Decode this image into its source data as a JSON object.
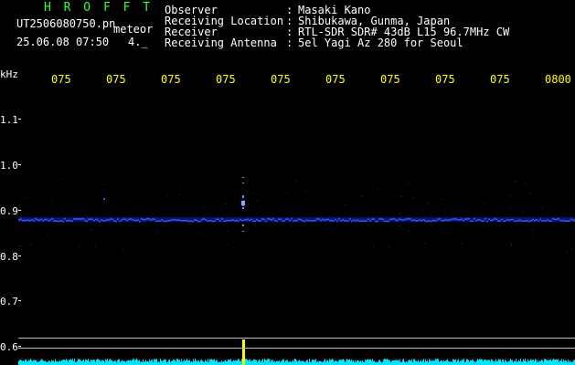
{
  "header": {
    "title": "H R O F F T",
    "filename": "UT2506080750.pn",
    "tag": "meteor",
    "datetime": "25.06.08 07:50",
    "duration": "4._",
    "info": [
      {
        "label": "Observer",
        "sep": ":",
        "value": "Masaki Kano"
      },
      {
        "label": "Receiving Location",
        "sep": ":",
        "value": "Shibukawa, Gunma, Japan"
      },
      {
        "label": "Receiver",
        "sep": ":",
        "value": "RTL-SDR SDR# 43dB L15 96.7MHz CW"
      },
      {
        "label": "Receiving Antenna",
        "sep": ":",
        "value": "5el Yagi Az 280 for Seoul"
      }
    ]
  },
  "axis": {
    "unit": "kHz",
    "time_ticks": [
      "075",
      "075",
      "075",
      "075",
      "075",
      "075",
      "075",
      "075",
      "075",
      "0800"
    ],
    "freq_ticks": [
      "1.1",
      "1.0",
      "0.9",
      "0.8",
      "0.7",
      "0.6"
    ]
  },
  "colors": {
    "header_green": "#33ff33",
    "axis_yellow": "#ffff00",
    "signal_blue": "#3355ff",
    "power_cyan": "#00e5ff",
    "spike_yellow": "#ffff00"
  }
}
